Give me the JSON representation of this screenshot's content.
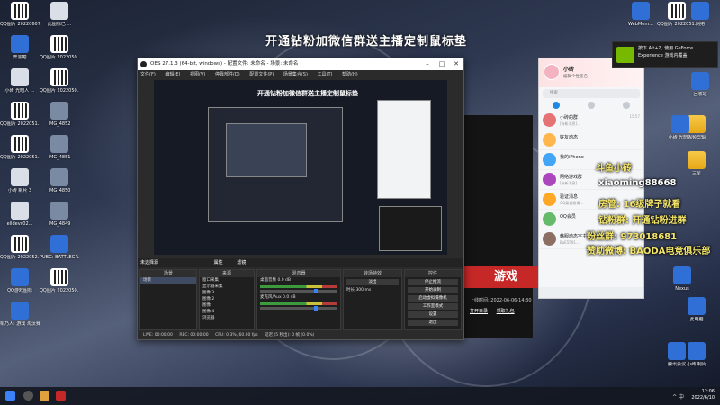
{
  "stream_banner": "开通钻粉加微信群送主播定制鼠标垫",
  "desktop_icons_left": [
    {
      "label": "QQ图片 20220607",
      "kind": "qr"
    },
    {
      "label": "此图标已 ...",
      "kind": "doc"
    },
    {
      "label": "开黑吧",
      "kind": "app"
    },
    {
      "label": "QQ图片 2022050...",
      "kind": "qr"
    },
    {
      "label": "小砖 光暗人 ...",
      "kind": "doc"
    },
    {
      "label": "QQ图片 2022050...",
      "kind": "qr"
    },
    {
      "label": "QQ图片 2022051...",
      "kind": "qr"
    },
    {
      "label": "IMG_4852",
      "kind": "img"
    },
    {
      "label": "QQ图片 2022051...",
      "kind": "qr"
    },
    {
      "label": "IMG_4851",
      "kind": "img"
    },
    {
      "label": "小砖 制片 3",
      "kind": "doc"
    },
    {
      "label": "IMG_4850",
      "kind": "img"
    },
    {
      "label": "elldevs02...",
      "kind": "doc"
    },
    {
      "label": "IMG_4849",
      "kind": "img"
    },
    {
      "label": "QQ图片 2022052...",
      "kind": "qr"
    },
    {
      "label": "PUBG: BATTLEGR...",
      "kind": "app"
    },
    {
      "label": "QQ游戏图标",
      "kind": "app"
    },
    {
      "label": "QQ图片 2022050...",
      "kind": "qr"
    },
    {
      "label": "桐乃人: 游戏 淘汰赛",
      "kind": "app"
    }
  ],
  "desktop_icons_right": [
    {
      "label": "WebMem...",
      "kind": "app"
    },
    {
      "label": "QQ图片 2022051...",
      "kind": "qr"
    },
    {
      "label": "网络",
      "kind": "app"
    },
    {
      "label": "回收站",
      "kind": "app"
    },
    {
      "label": "视频剪辑",
      "kind": "folder"
    },
    {
      "label": "三星",
      "kind": "folder"
    },
    {
      "label": "小砖 光暗人",
      "kind": "app"
    },
    {
      "label": "此电脑",
      "kind": "app"
    },
    {
      "label": "Nexus",
      "kind": "app"
    },
    {
      "label": "腾讯会议",
      "kind": "app"
    },
    {
      "label": "小砖 制片",
      "kind": "app"
    }
  ],
  "obs": {
    "title": "OBS 27.1.3 (64-bit, windows) - 配置文件: 未命名 - 场景: 未命名",
    "menu": [
      "文件(F)",
      "编辑(E)",
      "视图(V)",
      "停靠部件(D)",
      "配置文件(P)",
      "场景集合(S)",
      "工具(T)",
      "帮助(H)"
    ],
    "toolbar_text": [
      "未选择源",
      "属性",
      "滤镜"
    ],
    "docks": {
      "scenes": {
        "title": "场景",
        "items": [
          "场景"
        ]
      },
      "sources": {
        "title": "来源",
        "items": [
          "窗口采集",
          "显示器采集",
          "图像 3",
          "图像 2",
          "图像",
          "图像 4",
          "浏览器"
        ]
      },
      "mixer": {
        "title": "混音器",
        "items": [
          "桌面音频",
          "麦克风/Aux"
        ],
        "levels": [
          "0.0 dB",
          "0.0 dB"
        ]
      },
      "transitions": {
        "title": "转场特效",
        "type": "淡出",
        "duration_label": "时长",
        "duration": "300 ms"
      },
      "controls": {
        "title": "控件",
        "buttons": [
          "停止推流",
          "开始录制",
          "启动虚拟摄像机",
          "工作室模式",
          "设置",
          "退出"
        ]
      }
    },
    "status": [
      "LIVE: 00:00:00",
      "REC: 00:00:00",
      "CPU: 0.3%, 60.00 fps",
      "延迟 (5 秒出): 0 帧 (0.0%)"
    ]
  },
  "bg_window": {
    "game_button": "游戏",
    "date_text": "上线时间: 2022-06-06-14:30",
    "links": [
      "打开目录",
      "领取礼包"
    ]
  },
  "qq": {
    "username": "小砖",
    "signature": "编辑个性签名",
    "search_placeholder": "搜索",
    "conversations": [
      {
        "name": "小砖的群",
        "msg": "[有新消息]...",
        "time": "15:57",
        "color": "#e57373"
      },
      {
        "name": "好友动态",
        "msg": "",
        "time": "",
        "color": "#ffb74d"
      },
      {
        "name": "我的iPhone",
        "msg": "",
        "time": "",
        "color": "#42a5f5"
      },
      {
        "name": "网络游戏群",
        "msg": "[有新消息]",
        "time": "",
        "color": "#ab47bc"
      },
      {
        "name": "验证消息",
        "msg": "QQ渠道邀请...",
        "time": "",
        "color": "#ffa726"
      },
      {
        "name": "QQ会员",
        "msg": "",
        "time": "",
        "color": "#66bb6a"
      },
      {
        "name": "韩服动态字主 KAKAO有限",
        "msg": "BaE5591...",
        "time": "",
        "color": "#8d6e63"
      }
    ]
  },
  "overlay": [
    {
      "text": "斗鱼小砖",
      "color": "#f5e76a"
    },
    {
      "text": "xiaoming88668",
      "color": "#ffffff"
    },
    {
      "text": "房管: 16级牌子就看",
      "color": "#f5e76a"
    },
    {
      "text": "钻粉群: 开通钻粉进群",
      "color": "#f5e76a"
    },
    {
      "text": "粉丝群: 973018681",
      "color": "#f5e76a"
    },
    {
      "text": "赞助微博: BAODA电竞俱乐部",
      "color": "#f5e76a"
    }
  ],
  "toast": {
    "text": "按下 Alt+Z, 使用 GeForce Experience 游戏内覆盖"
  },
  "taskbar": {
    "time": "12:06",
    "date": "2022/6/10",
    "tray": "^ 中"
  },
  "colors": {
    "accent": "#1e88e5",
    "live_red": "#c62828",
    "nvidia_green": "#76b900"
  }
}
